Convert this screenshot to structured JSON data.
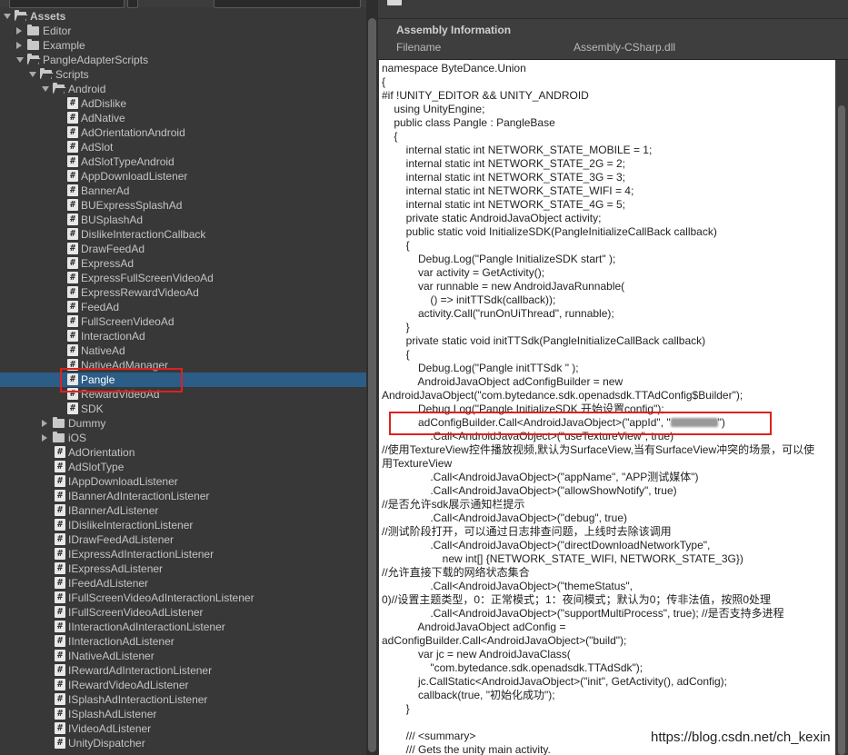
{
  "project_tree": {
    "rows": [
      {
        "label": "Assets",
        "depth": 0,
        "kind": "folder",
        "expanded": true,
        "bold": true
      },
      {
        "label": "Editor",
        "depth": 1,
        "kind": "folder",
        "expanded": false
      },
      {
        "label": "Example",
        "depth": 1,
        "kind": "folder",
        "expanded": false
      },
      {
        "label": "PangleAdapterScripts",
        "depth": 1,
        "kind": "folder",
        "expanded": true
      },
      {
        "label": "Scripts",
        "depth": 2,
        "kind": "folder",
        "expanded": true
      },
      {
        "label": "Android",
        "depth": 3,
        "kind": "folder",
        "expanded": true
      },
      {
        "label": "AdDislike",
        "depth": 4,
        "kind": "script"
      },
      {
        "label": "AdNative",
        "depth": 4,
        "kind": "script"
      },
      {
        "label": "AdOrientationAndroid",
        "depth": 4,
        "kind": "script"
      },
      {
        "label": "AdSlot",
        "depth": 4,
        "kind": "script"
      },
      {
        "label": "AdSlotTypeAndroid",
        "depth": 4,
        "kind": "script"
      },
      {
        "label": "AppDownloadListener",
        "depth": 4,
        "kind": "script"
      },
      {
        "label": "BannerAd",
        "depth": 4,
        "kind": "script"
      },
      {
        "label": "BUExpressSplashAd",
        "depth": 4,
        "kind": "script"
      },
      {
        "label": "BUSplashAd",
        "depth": 4,
        "kind": "script"
      },
      {
        "label": "DislikeInteractionCallback",
        "depth": 4,
        "kind": "script"
      },
      {
        "label": "DrawFeedAd",
        "depth": 4,
        "kind": "script"
      },
      {
        "label": "ExpressAd",
        "depth": 4,
        "kind": "script"
      },
      {
        "label": "ExpressFullScreenVideoAd",
        "depth": 4,
        "kind": "script"
      },
      {
        "label": "ExpressRewardVideoAd",
        "depth": 4,
        "kind": "script"
      },
      {
        "label": "FeedAd",
        "depth": 4,
        "kind": "script"
      },
      {
        "label": "FullScreenVideoAd",
        "depth": 4,
        "kind": "script"
      },
      {
        "label": "InteractionAd",
        "depth": 4,
        "kind": "script"
      },
      {
        "label": "NativeAd",
        "depth": 4,
        "kind": "script"
      },
      {
        "label": "NativeAdManager",
        "depth": 4,
        "kind": "script"
      },
      {
        "label": "Pangle",
        "depth": 4,
        "kind": "script",
        "selected": true
      },
      {
        "label": "RewardVideoAd",
        "depth": 4,
        "kind": "script"
      },
      {
        "label": "SDK",
        "depth": 4,
        "kind": "script"
      },
      {
        "label": "Dummy",
        "depth": 3,
        "kind": "folder",
        "expanded": false
      },
      {
        "label": "iOS",
        "depth": 3,
        "kind": "folder",
        "expanded": false
      },
      {
        "label": "AdOrientation",
        "depth": 3,
        "kind": "script"
      },
      {
        "label": "AdSlotType",
        "depth": 3,
        "kind": "script"
      },
      {
        "label": "IAppDownloadListener",
        "depth": 3,
        "kind": "script"
      },
      {
        "label": "IBannerAdInteractionListener",
        "depth": 3,
        "kind": "script"
      },
      {
        "label": "IBannerAdListener",
        "depth": 3,
        "kind": "script"
      },
      {
        "label": "IDislikeInteractionListener",
        "depth": 3,
        "kind": "script"
      },
      {
        "label": "IDrawFeedAdListener",
        "depth": 3,
        "kind": "script"
      },
      {
        "label": "IExpressAdInteractionListener",
        "depth": 3,
        "kind": "script"
      },
      {
        "label": "IExpressAdListener",
        "depth": 3,
        "kind": "script"
      },
      {
        "label": "IFeedAdListener",
        "depth": 3,
        "kind": "script"
      },
      {
        "label": "IFullScreenVideoAdInteractionListener",
        "depth": 3,
        "kind": "script"
      },
      {
        "label": "IFullScreenVideoAdListener",
        "depth": 3,
        "kind": "script"
      },
      {
        "label": "IInteractionAdInteractionListener",
        "depth": 3,
        "kind": "script"
      },
      {
        "label": "IInteractionAdListener",
        "depth": 3,
        "kind": "script"
      },
      {
        "label": "INativeAdListener",
        "depth": 3,
        "kind": "script"
      },
      {
        "label": "IRewardAdInteractionListener",
        "depth": 3,
        "kind": "script"
      },
      {
        "label": "IRewardVideoAdListener",
        "depth": 3,
        "kind": "script"
      },
      {
        "label": "ISplashAdInteractionListener",
        "depth": 3,
        "kind": "script"
      },
      {
        "label": "ISplashAdListener",
        "depth": 3,
        "kind": "script"
      },
      {
        "label": "IVideoAdListener",
        "depth": 3,
        "kind": "script"
      },
      {
        "label": "UnityDispatcher",
        "depth": 3,
        "kind": "script"
      }
    ]
  },
  "inspector": {
    "section_title": "Assembly Information",
    "filename_label": "Filename",
    "filename_value": "Assembly-CSharp.dll"
  },
  "code_lines": [
    "namespace ByteDance.Union",
    "{",
    "#if !UNITY_EDITOR && UNITY_ANDROID",
    "    using UnityEngine;",
    "    public class Pangle : PangleBase",
    "    {",
    "        internal static int NETWORK_STATE_MOBILE = 1;",
    "        internal static int NETWORK_STATE_2G = 2;",
    "        internal static int NETWORK_STATE_3G = 3;",
    "        internal static int NETWORK_STATE_WIFI = 4;",
    "        internal static int NETWORK_STATE_4G = 5;",
    "        private static AndroidJavaObject activity;",
    "        public static void InitializeSDK(PangleInitializeCallBack callback)",
    "        {",
    "            Debug.Log(\"Pangle InitializeSDK start\" );",
    "            var activity = GetActivity();",
    "            var runnable = new AndroidJavaRunnable(",
    "                () => initTTSdk(callback));",
    "            activity.Call(\"runOnUiThread\", runnable);",
    "        }",
    "        private static void initTTSdk(PangleInitializeCallBack callback)",
    "        {",
    "            Debug.Log(\"Pangle initTTSdk \" );",
    "            AndroidJavaObject adConfigBuilder = new",
    "AndroidJavaObject(\"com.bytedance.sdk.openadsdk.TTAdConfig$Builder\");",
    "            Debug.Log(\"Pangle InitializeSDK 开始设置config\");",
    "            adConfigBuilder.Call<AndroidJavaObject>(\"appId\", \"",
    "                .Call<AndroidJavaObject>(\"useTextureView\", true)",
    "//使用TextureView控件播放视频,默认为SurfaceView,当有SurfaceView冲突的场景，可以使",
    "用TextureView",
    "                .Call<AndroidJavaObject>(\"appName\", \"APP测试媒体\")",
    "                .Call<AndroidJavaObject>(\"allowShowNotify\", true)",
    "//是否允许sdk展示通知栏提示",
    "                .Call<AndroidJavaObject>(\"debug\", true)",
    "//测试阶段打开，可以通过日志排查问题，上线时去除该调用",
    "                .Call<AndroidJavaObject>(\"directDownloadNetworkType\",",
    "                    new int[] {NETWORK_STATE_WIFI, NETWORK_STATE_3G})",
    "//允许直接下载的网络状态集合",
    "                .Call<AndroidJavaObject>(\"themeStatus\",",
    "0)//设置主题类型，0：正常模式；1：夜间模式；默认为0；传非法值，按照0处理",
    "                .Call<AndroidJavaObject>(\"supportMultiProcess\", true); //是否支持多进程",
    "            AndroidJavaObject adConfig =",
    "adConfigBuilder.Call<AndroidJavaObject>(\"build\");",
    "            var jc = new AndroidJavaClass(",
    "                \"com.bytedance.sdk.openadsdk.TTAdSdk\");",
    "            jc.CallStatic<AndroidJavaObject>(\"init\", GetActivity(), adConfig);",
    "            callback(true, \"初始化成功\");",
    "        }",
    "",
    "        /// <summary>",
    "        /// Gets the unity main activity."
  ],
  "code_tail_after_redaction": "\")",
  "watermark": "https://blog.csdn.net/ch_kexin"
}
